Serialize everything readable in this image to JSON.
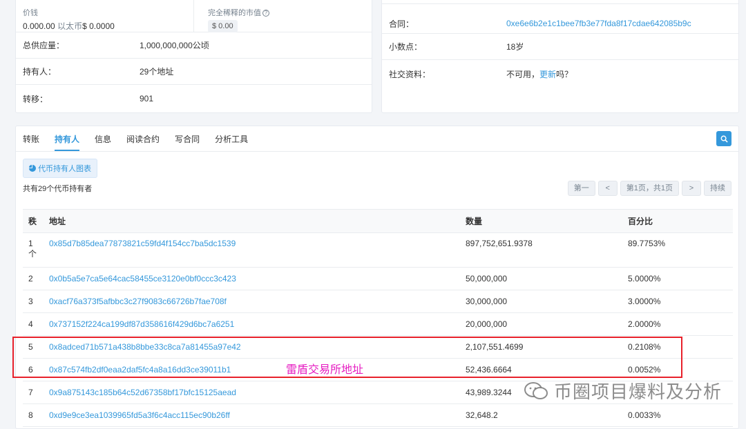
{
  "overview": {
    "price_label": "价钱",
    "price_value": "0.000.00",
    "price_unit": "以太币",
    "price_usd": "$ 0.0000",
    "mcap_label": "完全稀释的市值",
    "mcap_help": "?",
    "mcap_value": "$ 0.00",
    "rows": [
      {
        "key": "总供应量：",
        "value": "1,000,000,000公顷"
      },
      {
        "key": "持有人：",
        "value": "29个地址"
      },
      {
        "key": "转移：",
        "value": "901"
      }
    ]
  },
  "profile": {
    "contract_label": "合同：",
    "contract_value": "0xe6e6b2e1c1bee7fb3e77fda8f17cdae642085b9c",
    "decimals_label": "小数点：",
    "decimals_value": "18岁",
    "social_label": "社交资料：",
    "social_prefix": "不可用，",
    "social_link": "更新",
    "social_suffix": "吗？"
  },
  "tabs": [
    "转账",
    "持有人",
    "信息",
    "阅读合约",
    "写合同",
    "分析工具"
  ],
  "active_tab": "持有人",
  "holders": {
    "chart_button": "代币持有人图表",
    "count_text": "共有29个代币持有者",
    "pager": {
      "first": "第一",
      "prev": "<",
      "info": "第1页，共1页",
      "next": ">",
      "last": "持续"
    },
    "columns": [
      "秩",
      "地址",
      "数量",
      "百分比"
    ],
    "rows": [
      {
        "rank": "1\n个",
        "address": "0x85d7b85dea77873821c59fd4f154cc7ba5dc1539",
        "qty": "897,752,651.9378",
        "pct": "89.7753%"
      },
      {
        "rank": "2",
        "address": "0x0b5a5e7ca5e64cac58455ce3120e0bf0ccc3c423",
        "qty": "50,000,000",
        "pct": "5.0000%"
      },
      {
        "rank": "3",
        "address": "0xacf76a373f5afbbc3c27f9083c66726b7fae708f",
        "qty": "30,000,000",
        "pct": "3.0000%"
      },
      {
        "rank": "4",
        "address": "0x737152f224ca199df87d358616f429d6bc7a6251",
        "qty": "20,000,000",
        "pct": "2.0000%"
      },
      {
        "rank": "5",
        "address": "0x8adced71b571a438b8bbe33c8ca7a81455a97e42",
        "qty": "2,107,551.4699",
        "pct": "0.2108%"
      },
      {
        "rank": "6",
        "address": "0x87c574fb2df0eaa2daf5fc4a8a16dd3ce39011b1",
        "qty": "52,436.6664",
        "pct": "0.0052%"
      },
      {
        "rank": "7",
        "address": "0x9a875143c185b64c52d67358bf17bfc15125aead",
        "qty": "43,989.3244",
        "pct": ""
      },
      {
        "rank": "8",
        "address": "0xd9e9ce3ea1039965fd5a3f6c4acc115ec90b26ff",
        "qty": "32,648.2",
        "pct": "0.0033%"
      }
    ]
  },
  "annotation": "雷盾交易所地址",
  "watermark": "币圈项目爆料及分析",
  "colors": {
    "link": "#3498db",
    "annotation": "#e61ec2",
    "highlight": "#e8202a"
  }
}
